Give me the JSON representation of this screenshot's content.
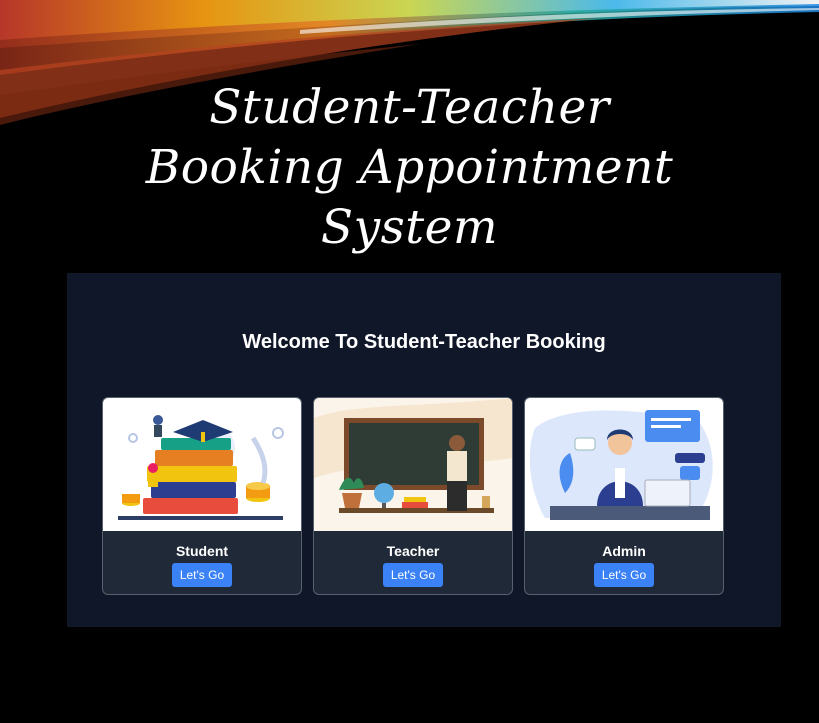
{
  "slide": {
    "title_lines": [
      "Student-Teacher",
      "Booking Appointment",
      "System"
    ]
  },
  "app": {
    "welcome_heading": "Welcome To Student-Teacher Booking",
    "cards": [
      {
        "title": "Student",
        "button_label": "Let's Go",
        "illustration": "student-books-illustration"
      },
      {
        "title": "Teacher",
        "button_label": "Let's Go",
        "illustration": "teacher-chalkboard-illustration"
      },
      {
        "title": "Admin",
        "button_label": "Let's Go",
        "illustration": "admin-support-illustration"
      }
    ]
  },
  "colors": {
    "background": "#000000",
    "app_background": "#0f1728",
    "card_body": "#1f2937",
    "button": "#3b82f6",
    "text": "#ffffff"
  }
}
